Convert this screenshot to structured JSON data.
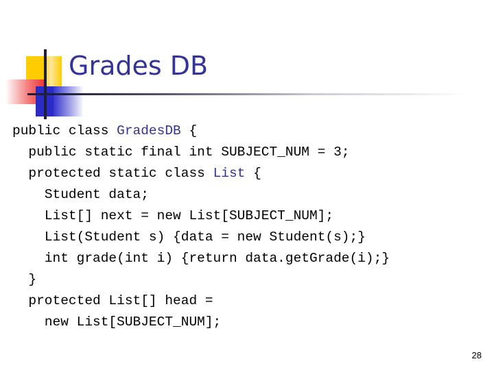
{
  "slide": {
    "title": "Grades DB",
    "page_number": "28",
    "title_color": "#333399",
    "accent_colors": {
      "yellow": "#FFCC00",
      "red": "#EE3333",
      "blue": "#2B2BC8",
      "rule": "#1F1F3A"
    }
  },
  "code": {
    "lines": [
      {
        "indent": 0,
        "segments": [
          {
            "text": "public class ",
            "type": "plain"
          },
          {
            "text": "GradesDB",
            "type": "typename"
          },
          {
            "text": " {",
            "type": "plain"
          }
        ]
      },
      {
        "indent": 1,
        "segments": [
          {
            "text": "public static final int SUBJECT_NUM = 3;",
            "type": "plain"
          }
        ]
      },
      {
        "indent": 1,
        "segments": [
          {
            "text": "protected static class ",
            "type": "plain"
          },
          {
            "text": "List",
            "type": "typename"
          },
          {
            "text": " {",
            "type": "plain"
          }
        ]
      },
      {
        "indent": 2,
        "segments": [
          {
            "text": "Student data;",
            "type": "plain"
          }
        ]
      },
      {
        "indent": 2,
        "segments": [
          {
            "text": "List[] next = new List[SUBJECT_NUM];",
            "type": "plain"
          }
        ]
      },
      {
        "indent": 2,
        "segments": [
          {
            "text": "List(Student s) {data = new Student(s);}",
            "type": "plain"
          }
        ]
      },
      {
        "indent": 2,
        "segments": [
          {
            "text": "int grade(int i) {return data.getGrade(i);}",
            "type": "plain"
          }
        ]
      },
      {
        "indent": 1,
        "segments": [
          {
            "text": "}",
            "type": "plain"
          }
        ]
      },
      {
        "indent": 1,
        "segments": [
          {
            "text": "protected List[] head =",
            "type": "plain"
          }
        ]
      },
      {
        "indent": 2,
        "segments": [
          {
            "text": "new List[SUBJECT_NUM];",
            "type": "plain"
          }
        ]
      }
    ]
  }
}
